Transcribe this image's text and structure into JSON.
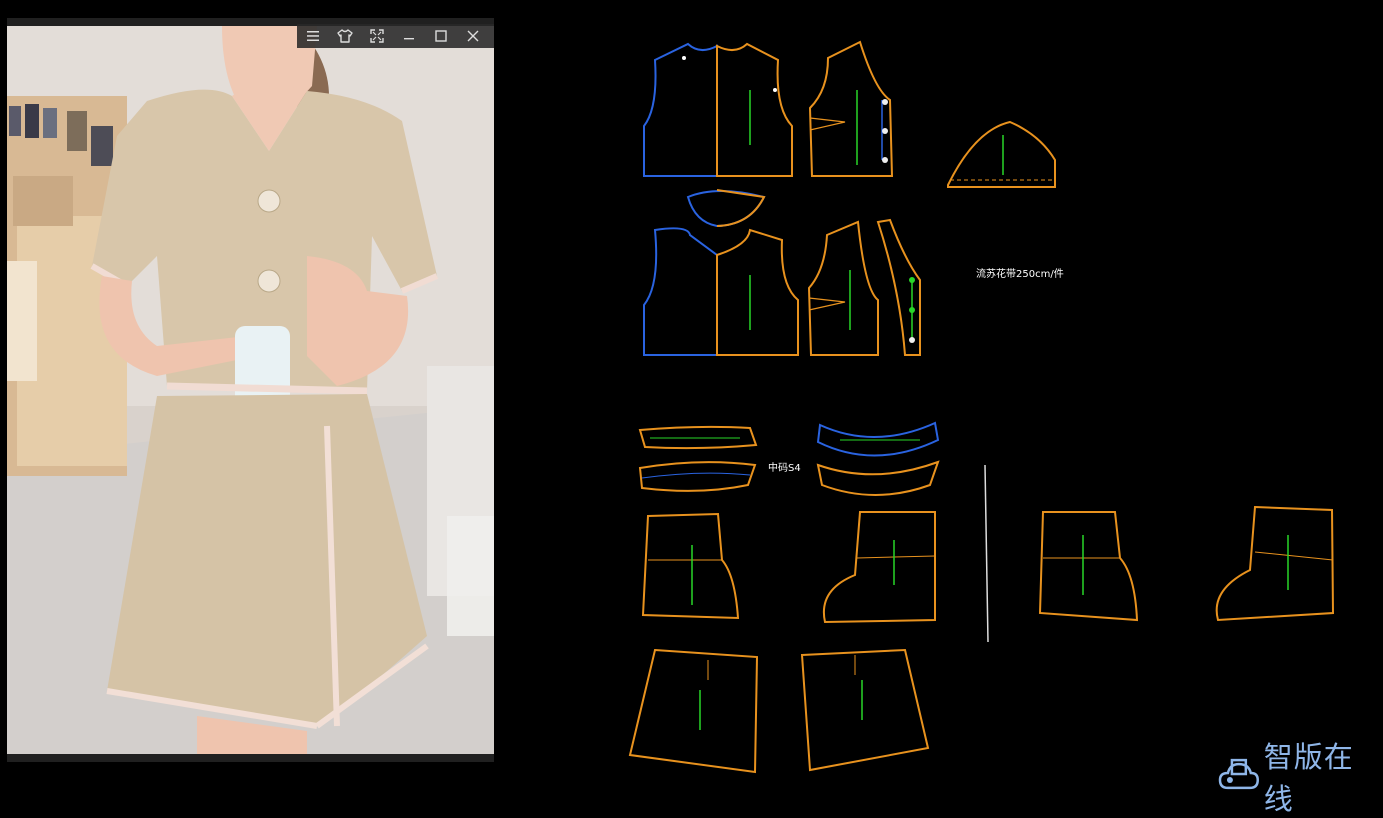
{
  "viewer": {
    "toolbar_icons": [
      "menu-icon",
      "shirt-icon",
      "fit-screen-icon",
      "minimize-icon",
      "maximize-icon",
      "close-icon"
    ]
  },
  "cad": {
    "labels": {
      "fringe_trim": "流苏花带250cm/件",
      "middle_size": "中码S4"
    },
    "colors": {
      "orange": "#e8921e",
      "blue": "#2a63e0",
      "green": "#29d629",
      "white": "#ffffff"
    }
  },
  "watermark": {
    "brand": "智版在线",
    "color": "#8fb6e8"
  }
}
